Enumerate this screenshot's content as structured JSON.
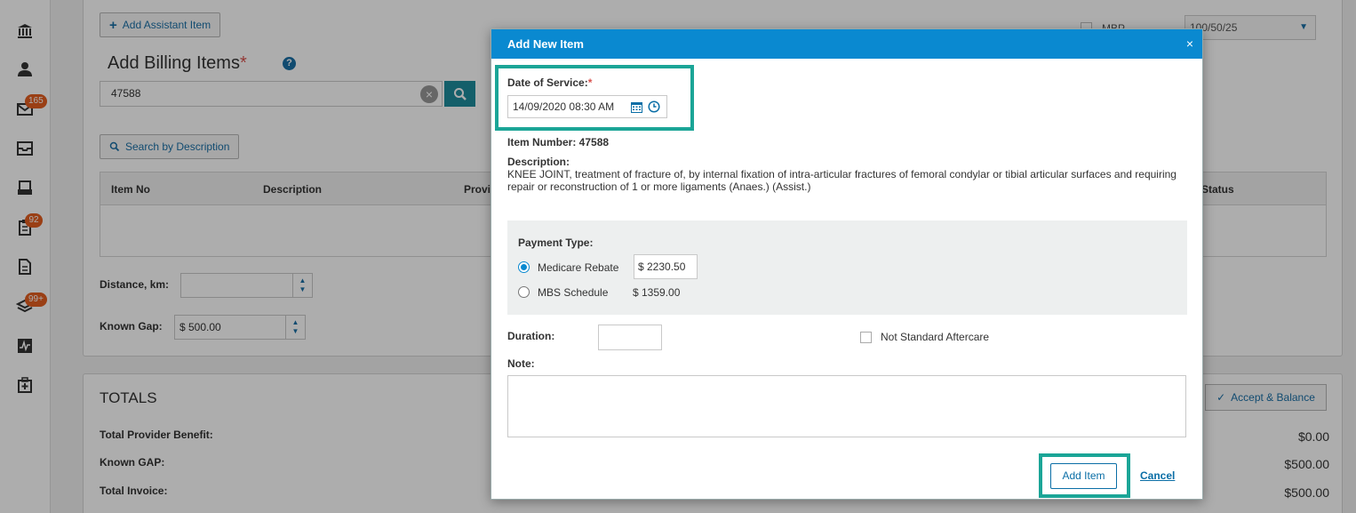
{
  "sidebar": {
    "badges": {
      "mail": "165",
      "tasks": "92",
      "layers": "99+"
    }
  },
  "background": {
    "add_assistant_label": "Add Assistant Item",
    "billing_title": "Add Billing Items",
    "billing_required_mark": "*",
    "help_glyph": "?",
    "search_value": "47588",
    "search_by_description_label": "Search by Description",
    "grid_columns": [
      "Item No",
      "Description",
      "Provi",
      "Status"
    ],
    "distance_label": "Distance, km:",
    "distance_value": "",
    "known_gap_label": "Known Gap:",
    "known_gap_value": "$ 500.00",
    "mbp_label": "MBP",
    "mbp_select_value": "100/50/25",
    "totals_title": "TOTALS",
    "accept_balance_label": "Accept & Balance",
    "totals": [
      {
        "label": "Total Provider Benefit:",
        "value": "$0.00"
      },
      {
        "label": "Known GAP:",
        "value": "$500.00"
      },
      {
        "label": "Total Invoice:",
        "value": "$500.00"
      }
    ]
  },
  "modal": {
    "title": "Add New Item",
    "close_glyph": "×",
    "date_of_service_label": "Date of Service:",
    "required_mark": "*",
    "date_of_service_value": "14/09/2020 08:30 AM",
    "item_number_label": "Item Number: 47588",
    "description_label": "Description:",
    "description_text": "KNEE JOINT, treatment of fracture of, by internal fixation of intra-articular fractures of femoral condylar or tibial articular surfaces and requiring repair or reconstruction of 1 or more ligaments (Anaes.) (Assist.)",
    "payment_type_label": "Payment Type:",
    "payment_options": [
      {
        "label": "Medicare Rebate",
        "value": "$ 2230.50",
        "selected": true
      },
      {
        "label": "MBS Schedule",
        "value": "$ 1359.00",
        "selected": false
      }
    ],
    "duration_label": "Duration:",
    "duration_value": "",
    "not_standard_aftercare_label": "Not Standard Aftercare",
    "note_label": "Note:",
    "note_value": "",
    "add_item_label": "Add Item",
    "cancel_label": "Cancel"
  },
  "colors": {
    "modal_header": "#0a89d0",
    "highlight": "#1ba597",
    "badge": "#e35d1f",
    "link": "#1a6fa6"
  }
}
